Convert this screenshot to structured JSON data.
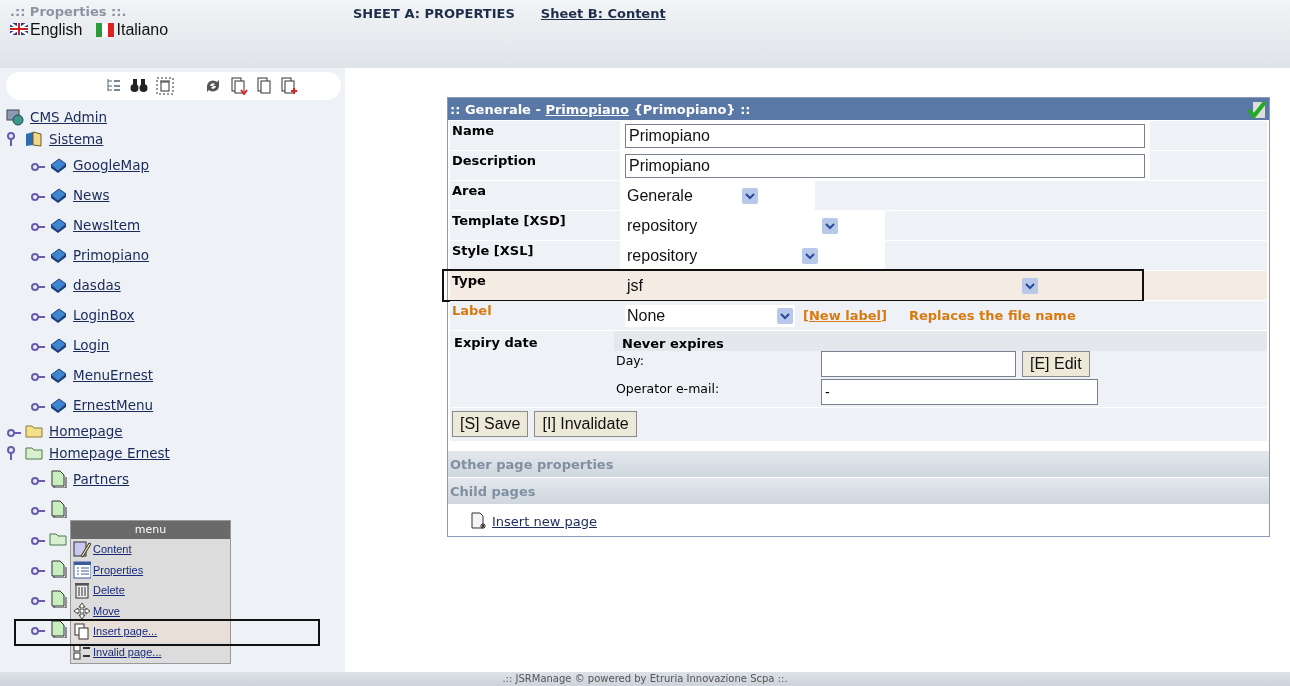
{
  "header": {
    "title": ".:: Properties ::.",
    "languages": [
      {
        "label": "English"
      },
      {
        "label": "Italiano"
      }
    ]
  },
  "sheets": [
    {
      "label": "SHEET A: PROPERTIES",
      "selected": true
    },
    {
      "label": "Sheet B: Content",
      "selected": false
    }
  ],
  "tree": [
    {
      "kind": "site",
      "label": "CMS Admin",
      "children": [
        {
          "kind": "system",
          "label": "Sistema",
          "expanded": true,
          "children": [
            {
              "kind": "book",
              "label": "GoogleMap"
            },
            {
              "kind": "book",
              "label": "News"
            },
            {
              "kind": "book",
              "label": "NewsItem"
            },
            {
              "kind": "book",
              "label": "Primopiano"
            },
            {
              "kind": "book",
              "label": "dasdas"
            },
            {
              "kind": "book",
              "label": "LoginBox"
            },
            {
              "kind": "book",
              "label": "Login"
            },
            {
              "kind": "book",
              "label": "MenuErnest"
            },
            {
              "kind": "book",
              "label": "ErnestMenu"
            }
          ]
        },
        {
          "kind": "folder",
          "label": "Homepage",
          "expanded": false
        },
        {
          "kind": "section",
          "label": "Homepage Ernest",
          "expanded": true,
          "children": [
            {
              "kind": "page",
              "label": "Partners"
            },
            {
              "kind": "page"
            },
            {
              "kind": "section"
            },
            {
              "kind": "page"
            },
            {
              "kind": "page"
            },
            {
              "kind": "page"
            }
          ]
        }
      ]
    }
  ],
  "context_menu": {
    "title": "menu",
    "items": [
      {
        "label": "Content",
        "highlighted": false
      },
      {
        "label": "Properties",
        "highlighted": false
      },
      {
        "label": "Delete",
        "highlighted": false
      },
      {
        "label": "Move",
        "highlighted": false
      },
      {
        "label": "Insert page...",
        "highlighted": true
      },
      {
        "label": "Invalid page...",
        "highlighted": false
      }
    ]
  },
  "form": {
    "title_prefix": ":: Generale - ",
    "title_link": "Primopiano",
    "title_suffix": " {Primopiano} ::",
    "fields": [
      {
        "kind": "text",
        "label": "Name",
        "value": "Primopiano",
        "highlighted": false
      },
      {
        "kind": "text",
        "label": "Description",
        "value": "Primopiano",
        "highlighted": false
      },
      {
        "kind": "select",
        "label": "Area",
        "value": "Generale",
        "highlighted": false
      },
      {
        "kind": "select",
        "label": "Template [XSD]",
        "value": "repository",
        "highlighted": false
      },
      {
        "kind": "select",
        "label": "Style [XSL]",
        "value": "repository",
        "highlighted": false
      },
      {
        "kind": "select",
        "label": "Type",
        "value": "jsf",
        "highlighted": true
      },
      {
        "kind": "label-select",
        "label": "Label",
        "value": "None",
        "link": "[New label]",
        "note": "Replaces the file name",
        "highlighted": false
      }
    ],
    "expiry": {
      "label": "Expiry date",
      "status": "Never expires",
      "day_label": "Day:",
      "edit_button": "[E] Edit",
      "email_label": "Operator e-mail:",
      "email_value": "-"
    },
    "buttons": [
      "[S] Save",
      "[I] Invalidate"
    ],
    "sections": [
      "Other page properties",
      "Child pages"
    ],
    "insert_link": "Insert new page"
  },
  "footer": ".:: JSRManage © powered by Etruria Innovazione Scpa ::."
}
